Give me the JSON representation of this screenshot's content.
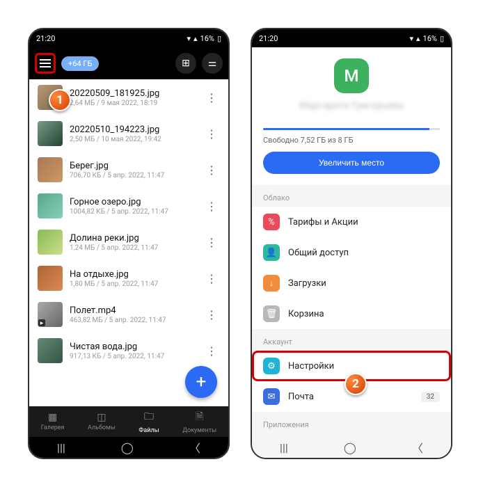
{
  "status": {
    "time": "21:20",
    "battery": "16%",
    "signal_icon": "📶",
    "wifi_icon": "📡"
  },
  "left": {
    "storage_pill": "+64 ГБ",
    "files": [
      {
        "name": "20220509_181925.jpg",
        "meta": "2,64 МБ / 9 мая 2022, 18:19"
      },
      {
        "name": "20220510_194223.jpg",
        "meta": "2,50 МБ / 10 мая 2022, 19:42"
      },
      {
        "name": "Берег.jpg",
        "meta": "706,70 КБ / 5 апр. 2022, 11:47"
      },
      {
        "name": "Горное озеро.jpg",
        "meta": "1004,82 КБ / 5 апр. 2022, 11:47"
      },
      {
        "name": "Долина реки.jpg",
        "meta": "1,24 МБ / 5 апр. 2022, 11:47"
      },
      {
        "name": "На отдыхе.jpg",
        "meta": "1,80 МБ / 5 апр. 2022, 11:47"
      },
      {
        "name": "Полет.mp4",
        "meta": "463,82 МБ / 5 апр. 2022, 11:47"
      },
      {
        "name": "Чистая вода.jpg",
        "meta": "917,13 КБ / 5 апр. 2022, 11:47"
      }
    ],
    "nav": {
      "gallery": "Галерея",
      "albums": "Альбомы",
      "files": "Файлы",
      "docs": "Документы"
    }
  },
  "right": {
    "avatar_letter": "М",
    "storage_text": "Свободно 7,52 ГБ из 8 ГБ",
    "upgrade": "Увеличить место",
    "section_cloud": "Облако",
    "section_account": "Аккаунт",
    "section_apps": "Приложения",
    "menu": {
      "tariffs": "Тарифы и Акции",
      "shared": "Общий доступ",
      "downloads": "Загрузки",
      "trash": "Корзина",
      "settings": "Настройки",
      "mail": "Почта",
      "mail_count": "32"
    }
  },
  "anno": {
    "one": "1",
    "two": "2"
  }
}
